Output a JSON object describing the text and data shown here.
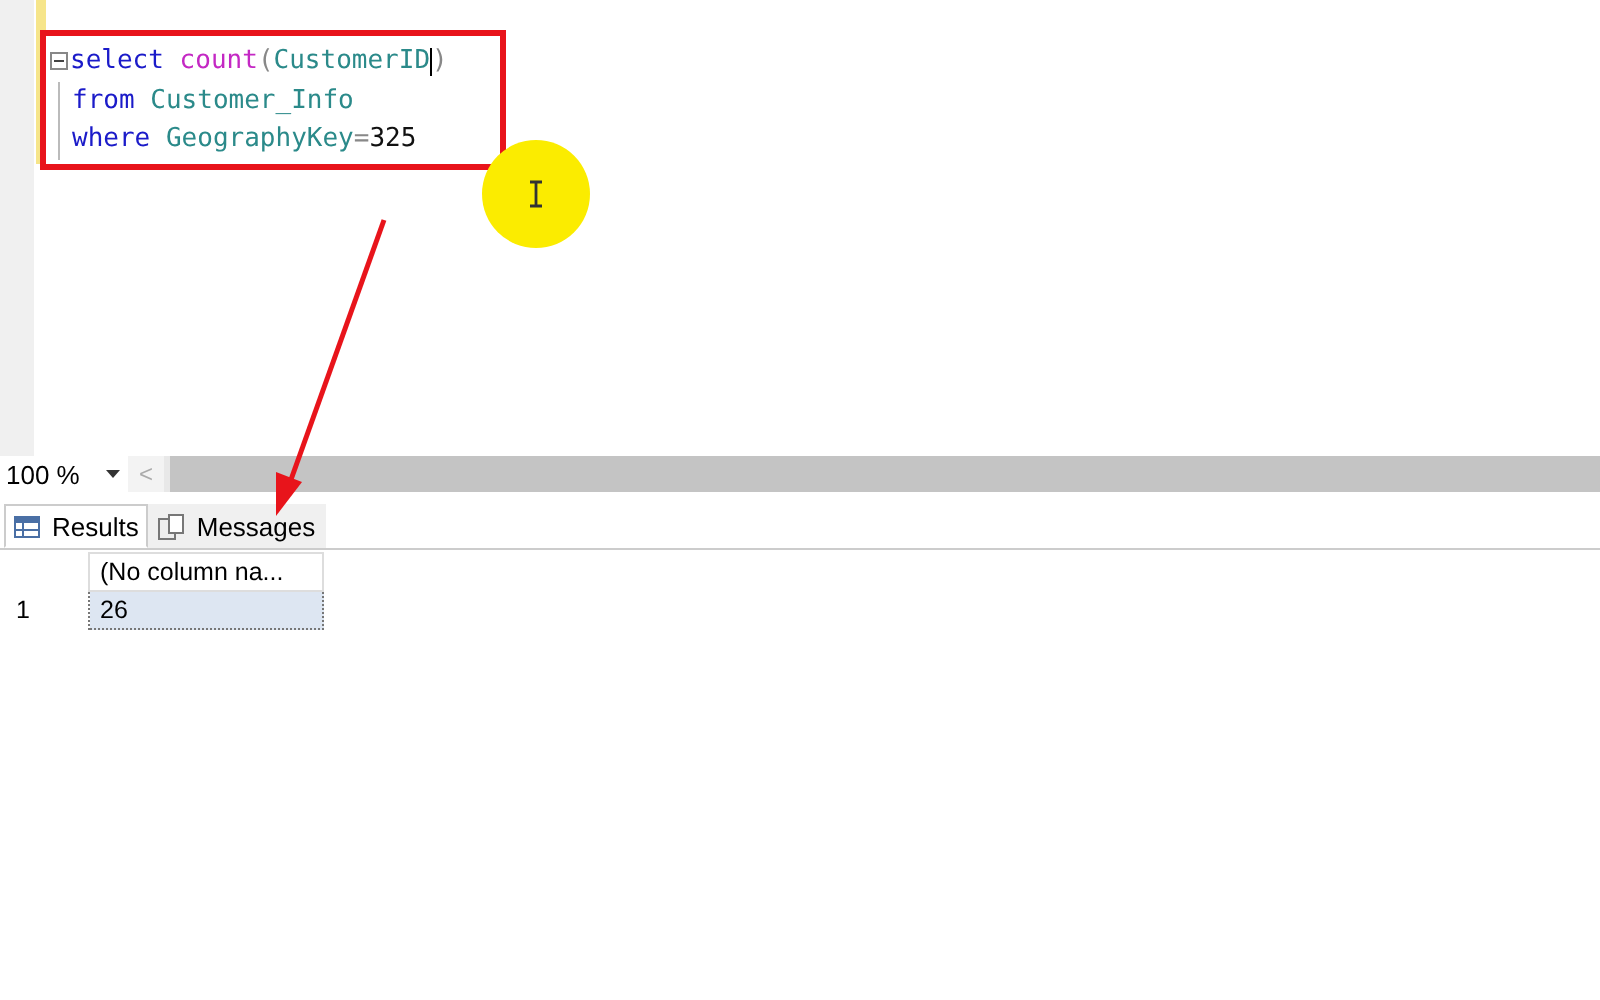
{
  "editor": {
    "lines": [
      {
        "collapsible": true,
        "tokens": [
          {
            "kind": "keyword",
            "text": "select "
          },
          {
            "kind": "function",
            "text": "count"
          },
          {
            "kind": "operator",
            "text": "("
          },
          {
            "kind": "identifier",
            "text": "CustomerID"
          },
          {
            "kind": "caret"
          },
          {
            "kind": "operator",
            "text": ")"
          }
        ]
      },
      {
        "collapsible": false,
        "tokens": [
          {
            "kind": "keyword",
            "text": "from "
          },
          {
            "kind": "identifier",
            "text": "Customer_Info"
          }
        ]
      },
      {
        "collapsible": false,
        "tokens": [
          {
            "kind": "keyword",
            "text": "where "
          },
          {
            "kind": "identifier",
            "text": "GeographyKey"
          },
          {
            "kind": "operator",
            "text": "="
          },
          {
            "kind": "number",
            "text": "325"
          }
        ]
      }
    ]
  },
  "zoom": {
    "value": "100 %",
    "scroll_left": "<"
  },
  "tabs": [
    {
      "label": "Results",
      "kind": "grid",
      "selected": true
    },
    {
      "label": "Messages",
      "kind": "messages",
      "selected": false
    }
  ],
  "grid": {
    "columns": [
      "(No column na..."
    ],
    "rows": [
      {
        "number": "1",
        "cells": [
          "26"
        ]
      }
    ]
  }
}
